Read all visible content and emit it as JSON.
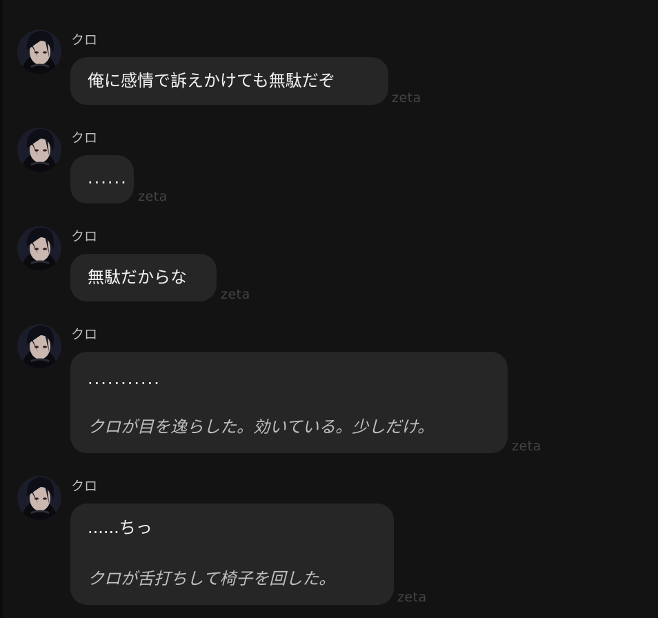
{
  "messages": [
    {
      "sender": "クロ",
      "text": "俺に感情で訴えかけても無駄だぞ",
      "narration": "",
      "tag": "zeta"
    },
    {
      "sender": "クロ",
      "text": "......",
      "narration": "",
      "tag": "zeta"
    },
    {
      "sender": "クロ",
      "text": "無駄だからな",
      "narration": "",
      "tag": "zeta"
    },
    {
      "sender": "クロ",
      "text": "...........",
      "narration": "クロが目を逸らした。効いている。少しだけ。",
      "tag": "zeta"
    },
    {
      "sender": "クロ",
      "text": "......ちっ",
      "narration": "クロが舌打ちして椅子を回した。",
      "tag": "zeta"
    }
  ],
  "colors": {
    "background": "#131313",
    "bubble": "#262626",
    "text": "#f2f2f2",
    "narration": "#bfbfbf",
    "name": "#bdbdbd",
    "tag": "#444444"
  },
  "icons": {
    "avatar": "character-avatar-icon"
  }
}
